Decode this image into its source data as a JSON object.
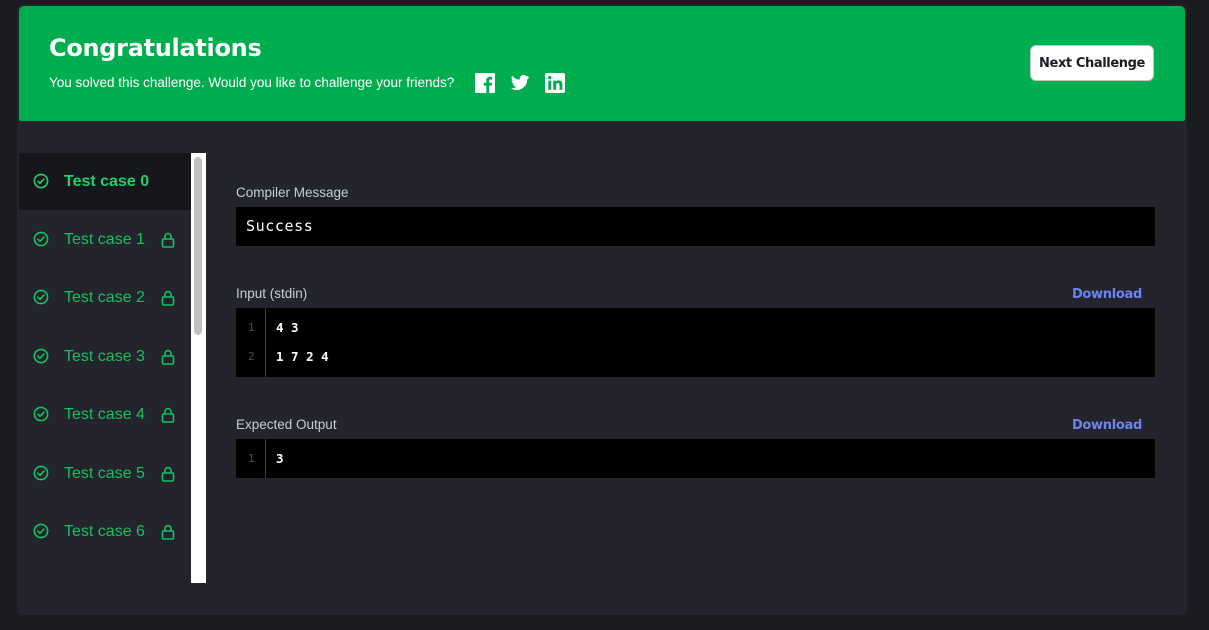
{
  "banner": {
    "title": "Congratulations",
    "subtitle": "You solved this challenge. Would you like to challenge your friends?",
    "social_icons": [
      "facebook-icon",
      "twitter-icon",
      "linkedin-icon"
    ],
    "next_button": "Next Challenge",
    "background_color": "#00ad4f"
  },
  "test_cases": [
    {
      "label": "Test case 0",
      "status_icon": "check-circle-icon",
      "locked": false,
      "active": true
    },
    {
      "label": "Test case 1",
      "status_icon": "check-circle-icon",
      "locked": true,
      "active": false
    },
    {
      "label": "Test case 2",
      "status_icon": "check-circle-icon",
      "locked": true,
      "active": false
    },
    {
      "label": "Test case 3",
      "status_icon": "check-circle-icon",
      "locked": true,
      "active": false
    },
    {
      "label": "Test case 4",
      "status_icon": "check-circle-icon",
      "locked": true,
      "active": false
    },
    {
      "label": "Test case 5",
      "status_icon": "check-circle-icon",
      "locked": true,
      "active": false
    },
    {
      "label": "Test case 6",
      "status_icon": "check-circle-icon",
      "locked": true,
      "active": false
    }
  ],
  "compiler": {
    "label": "Compiler Message",
    "message": "Success"
  },
  "input": {
    "label": "Input (stdin)",
    "download": "Download",
    "lines": [
      {
        "num": "1",
        "text": "4 3"
      },
      {
        "num": "2",
        "text": "1 7 2 4"
      }
    ]
  },
  "expected": {
    "label": "Expected Output",
    "download": "Download",
    "lines": [
      {
        "num": "1",
        "text": "3"
      }
    ]
  },
  "colors": {
    "accent_green": "#15c160",
    "link_blue": "#6b84f0",
    "panel_bg": "#23242c"
  }
}
